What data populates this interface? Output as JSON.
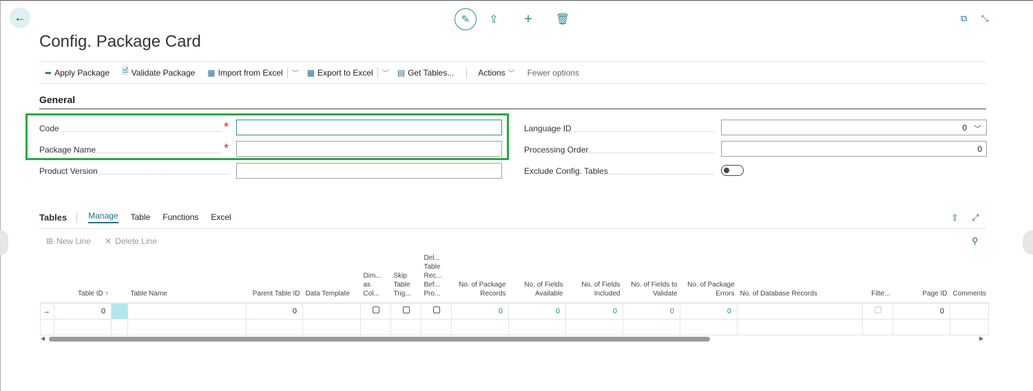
{
  "page": {
    "title": "Config. Package Card"
  },
  "icons": {
    "back": "back-arrow-icon",
    "edit": "pencil-icon",
    "share": "share-icon",
    "add": "plus-icon",
    "delete": "trash-icon",
    "open_new": "open-new-window-icon",
    "collapse": "collapse-icon"
  },
  "actions": [
    {
      "label": "Apply Package"
    },
    {
      "label": "Validate Package"
    },
    {
      "label": "Import from Excel"
    },
    {
      "label": "Export to Excel"
    },
    {
      "label": "Get Tables..."
    },
    {
      "label": "Actions"
    },
    {
      "label": "Fewer options"
    }
  ],
  "general": {
    "heading": "General",
    "code": {
      "label": "Code",
      "value": ""
    },
    "package_name": {
      "label": "Package Name",
      "value": ""
    },
    "product_version": {
      "label": "Product Version",
      "value": ""
    },
    "language_id": {
      "label": "Language ID",
      "value": "0"
    },
    "processing_order": {
      "label": "Processing Order",
      "value": "0"
    },
    "exclude_config_tables": {
      "label": "Exclude Config. Tables",
      "value": false
    }
  },
  "tables": {
    "heading": "Tables",
    "tabs": [
      "Manage",
      "Table",
      "Functions",
      "Excel"
    ],
    "new_line": "New Line",
    "delete_line": "Delete Line",
    "columns": [
      "Table ID ↑",
      "",
      "Table Name",
      "Parent Table ID",
      "Data Template",
      "Dim... as Col...",
      "Skip Table Trig...",
      "Del... Table Rec... Bef... Pro...",
      "No. of Package Records",
      "No. of Fields Available",
      "No. of Fields Included",
      "No. of Fields to Validate",
      "No. of Package Errors",
      "No. of Database Records",
      "Filte...",
      "Page ID",
      "Comments"
    ],
    "row": {
      "table_id": "0",
      "parent_table_id": "0",
      "no_package_records": "0",
      "no_fields_available": "0",
      "no_fields_included": "0",
      "no_fields_to_validate": "0",
      "no_package_errors": "0",
      "page_id": "0"
    }
  },
  "colors": {
    "accent": "#1f8a98",
    "highlight": "#27a844",
    "required": "#d0281f"
  }
}
